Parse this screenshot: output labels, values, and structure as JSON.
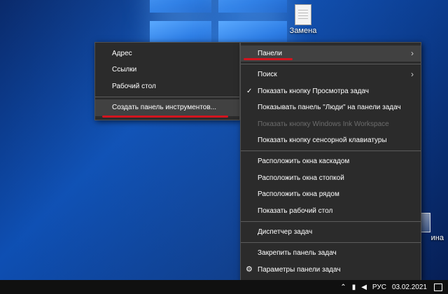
{
  "desktop": {
    "icons": [
      {
        "label": "Замена\nмужчины",
        "icon": "document-file-icon"
      },
      {
        "label": "ина",
        "icon": "recycle-bin-icon"
      }
    ]
  },
  "toolbars_submenu": {
    "items": [
      {
        "label": "Адрес"
      },
      {
        "label": "Ссылки"
      },
      {
        "label": "Рабочий стол"
      },
      {
        "label": "Создать панель инструментов..."
      }
    ]
  },
  "taskbar_menu": {
    "groups": [
      [
        {
          "label": "Панели",
          "submenu": true,
          "highlight": true
        }
      ],
      [
        {
          "label": "Поиск",
          "submenu": true
        },
        {
          "label": "Показать кнопку Просмотра задач",
          "checked": true
        },
        {
          "label": "Показывать панель \"Люди\" на панели задач"
        },
        {
          "label": "Показать кнопку Windows Ink Workspace",
          "disabled": true
        },
        {
          "label": "Показать кнопку сенсорной клавиатуры"
        }
      ],
      [
        {
          "label": "Расположить окна каскадом"
        },
        {
          "label": "Расположить окна стопкой"
        },
        {
          "label": "Расположить окна рядом"
        },
        {
          "label": "Показать рабочий стол"
        }
      ],
      [
        {
          "label": "Диспетчер задач"
        }
      ],
      [
        {
          "label": "Закрепить панель задач"
        },
        {
          "label": "Параметры панели задач",
          "icon": "gear-icon"
        }
      ]
    ]
  },
  "taskbar": {
    "tray": {
      "language": "РУС",
      "date": "03.02.2021"
    }
  },
  "colors": {
    "menu_bg": "#2b2b2b",
    "menu_highlight": "#414141",
    "annotation_red": "#d2141e"
  }
}
